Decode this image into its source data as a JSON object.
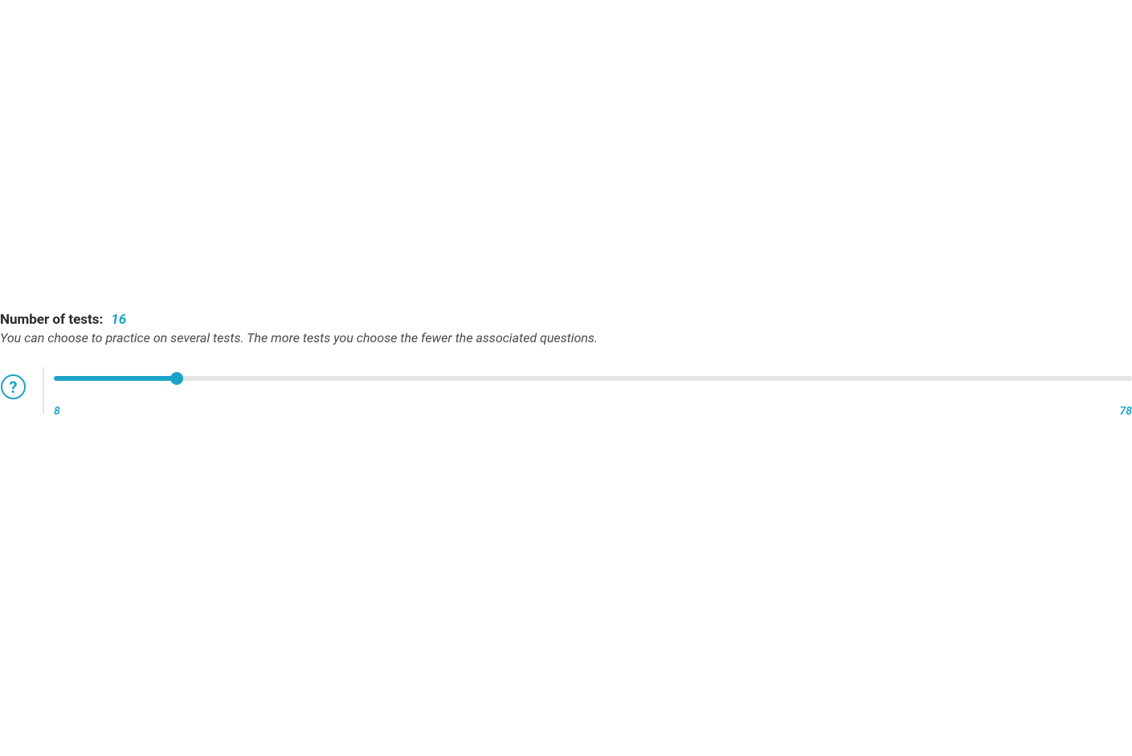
{
  "slider": {
    "title_label": "Number of tests:",
    "current_value": "16",
    "description": "You can choose to practice on several tests. The more tests you choose the fewer the associated questions.",
    "min": 8,
    "max": 78,
    "min_label": "8",
    "max_label": "78",
    "fill_percent": 11.4
  },
  "colors": {
    "accent": "#1ba3c7",
    "text_dark": "#2a2a2a",
    "text_muted": "#4a4a4a",
    "track": "#e5e5e5"
  }
}
